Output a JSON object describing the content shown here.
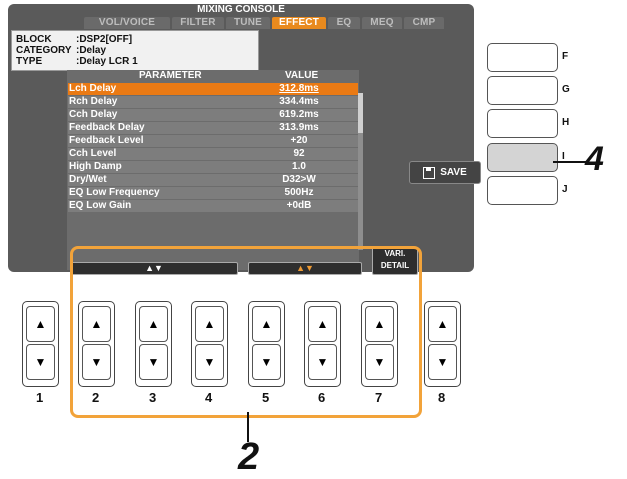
{
  "screen": {
    "title": "MIXING CONSOLE",
    "tabs": [
      {
        "label": "VOL/VOICE",
        "active": false
      },
      {
        "label": "FILTER",
        "active": false
      },
      {
        "label": "TUNE",
        "active": false
      },
      {
        "label": "EFFECT",
        "active": true
      },
      {
        "label": "EQ",
        "active": false
      },
      {
        "label": "MEQ",
        "active": false
      },
      {
        "label": "CMP",
        "active": false
      }
    ],
    "info": {
      "block_key": "BLOCK",
      "block_val": ":DSP2[OFF]",
      "category_key": "CATEGORY",
      "category_val": ":Delay",
      "type_key": "TYPE",
      "type_val": ":Delay LCR 1"
    },
    "columns": {
      "parameter": "PARAMETER",
      "value": "VALUE"
    },
    "rows": [
      {
        "name": "Lch Delay",
        "value": "312.8ms"
      },
      {
        "name": "Rch Delay",
        "value": "334.4ms"
      },
      {
        "name": "Cch Delay",
        "value": "619.2ms"
      },
      {
        "name": "Feedback Delay",
        "value": "313.9ms"
      },
      {
        "name": "Feedback Level",
        "value": "+20"
      },
      {
        "name": "Cch Level",
        "value": "92"
      },
      {
        "name": "High Damp",
        "value": "1.0"
      },
      {
        "name": "Dry/Wet",
        "value": "D32>W"
      },
      {
        "name": "EQ Low Frequency",
        "value": "500Hz"
      },
      {
        "name": "EQ Low Gain",
        "value": "+0dB"
      }
    ],
    "bar_left": "▲▼",
    "bar_right": "▲▼",
    "vari": "VARI.",
    "detail": "DETAIL",
    "save_label": "SAVE"
  },
  "side_buttons": [
    "F",
    "G",
    "H",
    "I",
    "J"
  ],
  "knob_labels": [
    "1",
    "2",
    "3",
    "4",
    "5",
    "6",
    "7",
    "8"
  ],
  "callouts": {
    "four": "4",
    "two": "2"
  },
  "arrows": {
    "up": "▲",
    "down": "▼"
  },
  "colors": {
    "accent": "#e98a1e",
    "highlight_frame": "#f2a33a"
  }
}
